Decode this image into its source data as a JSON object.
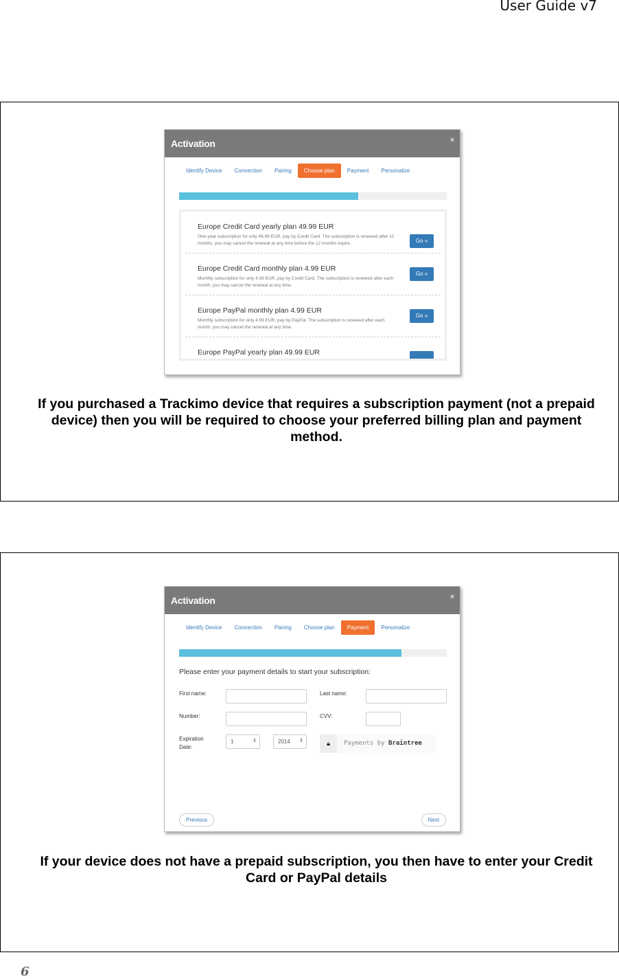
{
  "header": {
    "title": "User Guide v7"
  },
  "tabs": [
    "Identify Device",
    "Connection",
    "Pairing",
    "Choose plan",
    "Payment",
    "Personalize"
  ],
  "modal_title": "Activation",
  "close_icon": "×",
  "section1": {
    "active_tab": "Choose plan",
    "progress_percent": 67,
    "plans": [
      {
        "title": "Europe Credit Card yearly plan 49.99 EUR",
        "desc": "One-year subscription for only 49.99 EUR, pay by Credit Card. The subscription is renewed after 12 months, you may cancel the renewal at any time before the 12 months expire.",
        "button": "Go »"
      },
      {
        "title": "Europe Credit Card monthly plan 4.99 EUR",
        "desc": "Monthly subscription for only 4.99 EUR, pay by Credit Card. The subscription is renewed after each month, you may cancel the renewal at any time.",
        "button": "Go »"
      },
      {
        "title": "Europe PayPal monthly plan 4.99 EUR",
        "desc": "Monthly subscription for only 4.99 EUR, pay by PayPal. The subscription is renewed after each month, you may cancel the renewal at any time.",
        "button": "Go »"
      },
      {
        "title": "Europe PayPal yearly plan 49.99 EUR",
        "desc": "",
        "button": ""
      }
    ],
    "caption": "If you purchased a Trackimo device that requires a subscription payment (not a prepaid device) then you will be required to choose your preferred billing plan and payment method."
  },
  "section2": {
    "active_tab": "Payment",
    "progress_percent": 83,
    "intro": "Please enter your payment details to start your subscription:",
    "first_name_label": "First name:",
    "last_name_label": "Last name:",
    "number_label": "Number:",
    "cvv_label": "CVV:",
    "expiration_label": "Expiration Date:",
    "month_value": "1",
    "year_value": "2014",
    "braintree_prefix": "Payments by ",
    "braintree_brand": "Braintree",
    "previous": "Previous",
    "next": "Next",
    "caption": "If your device does not have a prepaid subscription, you then have to enter your Credit Card or PayPal details"
  },
  "page_number": "6"
}
